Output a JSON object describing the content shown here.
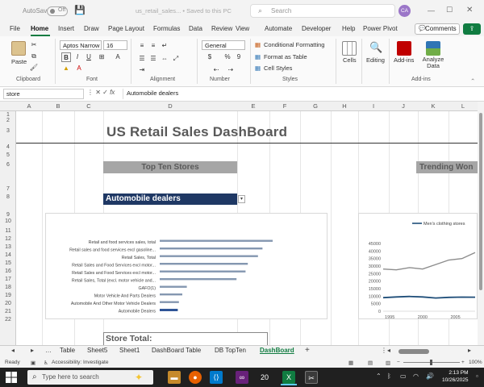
{
  "titlebar": {
    "autosave_label": "AutoSave",
    "autosave_state": "Off",
    "filename": "us_retail_sales... • Saved to this PC",
    "search_placeholder": "Search",
    "avatar_initials": "CA"
  },
  "menu": {
    "tabs": [
      "File",
      "Home",
      "Insert",
      "Draw",
      "Page Layout",
      "Formulas",
      "Data",
      "Review",
      "View",
      "Automate",
      "Developer",
      "Help",
      "Power Pivot"
    ],
    "active": "Home",
    "comments_label": "Comments"
  },
  "ribbon": {
    "clipboard": {
      "paste_label": "Paste",
      "group_label": "Clipboard"
    },
    "font": {
      "font_name": "Aptos Narrow",
      "font_size": "16",
      "group_label": "Font",
      "bold": "B",
      "italic": "I",
      "underline": "U"
    },
    "alignment": {
      "group_label": "Alignment"
    },
    "number": {
      "format": "General",
      "currency": "$",
      "percent": "%",
      "comma": "9",
      "group_label": "Number"
    },
    "styles": {
      "conditional_formatting": "Conditional Formatting",
      "format_as_table": "Format as Table",
      "cell_styles": "Cell Styles",
      "group_label": "Styles"
    },
    "cells_label": "Cells",
    "editing_label": "Editing",
    "addins_label": "Add-ins",
    "analyze_label": "Analyze Data",
    "addins_group_label": "Add-ins"
  },
  "formula_bar": {
    "name_box": "store",
    "fx": "fx",
    "value": "Automobile dealers"
  },
  "columns": [
    "A",
    "B",
    "C",
    "D",
    "E",
    "F",
    "G",
    "H",
    "I",
    "J",
    "K",
    "L"
  ],
  "rows": [
    "1",
    "2",
    "3",
    "4",
    "5",
    "6",
    "7",
    "8",
    "9",
    "10",
    "11",
    "12",
    "13",
    "14",
    "15",
    "16",
    "17",
    "18",
    "19",
    "20",
    "21",
    "22"
  ],
  "dashboard": {
    "title": "US Retail Sales DashBoard",
    "top_ten_header": "Top Ten Stores",
    "trending_header": "Trending Won",
    "dropdown_value": "Automobile dealers",
    "store_total_label": "Store Total:"
  },
  "chart_data": [
    {
      "type": "bar",
      "categories": [
        "Retail and food services sales, total",
        "Retail sales and food services excl gasoline...",
        "Retail Sales, Total",
        "Retail Sales and Food Services excl motor...",
        "Retail Sales and Food Services excl motor...",
        "Retail Sales, Total (excl. motor vehicle and...",
        "GAFO(1)",
        "Motor Vehicle And Parts Dealers",
        "Automobile And Other Motor Vehicle Dealers",
        "Automobile Dealers"
      ],
      "values": [
        100,
        91,
        87,
        78,
        76,
        68,
        24,
        20,
        17,
        16
      ],
      "bar_color": "#8497b0",
      "highlight_color": "#2f5597"
    },
    {
      "type": "line",
      "x": [
        1995,
        2000,
        2005
      ],
      "x_range": [
        1994,
        2008
      ],
      "ylim": [
        0,
        45000
      ],
      "y_ticks": [
        "45000",
        "40000",
        "35000",
        "30000",
        "25000",
        "20000",
        "15000",
        "10000",
        "5000",
        "0"
      ],
      "x_ticks": [
        "1995",
        "2000",
        "2005"
      ],
      "series": [
        {
          "name": "Men's clothing stores",
          "color": "#1f4e79",
          "points": [
            [
              1994,
              9000
            ],
            [
              1996,
              9500
            ],
            [
              1998,
              9800
            ],
            [
              2000,
              9500
            ],
            [
              2002,
              8800
            ],
            [
              2004,
              9200
            ],
            [
              2006,
              9400
            ],
            [
              2008,
              9300
            ]
          ]
        },
        {
          "name": "",
          "color": "#8c8c8c",
          "points": [
            [
              1994,
              28000
            ],
            [
              1996,
              27500
            ],
            [
              1998,
              29000
            ],
            [
              2000,
              28000
            ],
            [
              2002,
              31000
            ],
            [
              2004,
              34000
            ],
            [
              2006,
              35000
            ],
            [
              2008,
              39000
            ]
          ]
        }
      ]
    }
  ],
  "sheet_tabs": [
    "Table",
    "Sheet5",
    "Sheet1",
    "DashBoard Table",
    "DB TopTen",
    "DashBoard"
  ],
  "active_sheet": "DashBoard",
  "status": {
    "ready": "Ready",
    "accessibility": "Accessibility: Investigate",
    "zoom": "100%"
  },
  "taskbar": {
    "search_placeholder": "Type here to search",
    "badge": "20",
    "time": "2:13 PM",
    "date": "10/26/2025"
  }
}
